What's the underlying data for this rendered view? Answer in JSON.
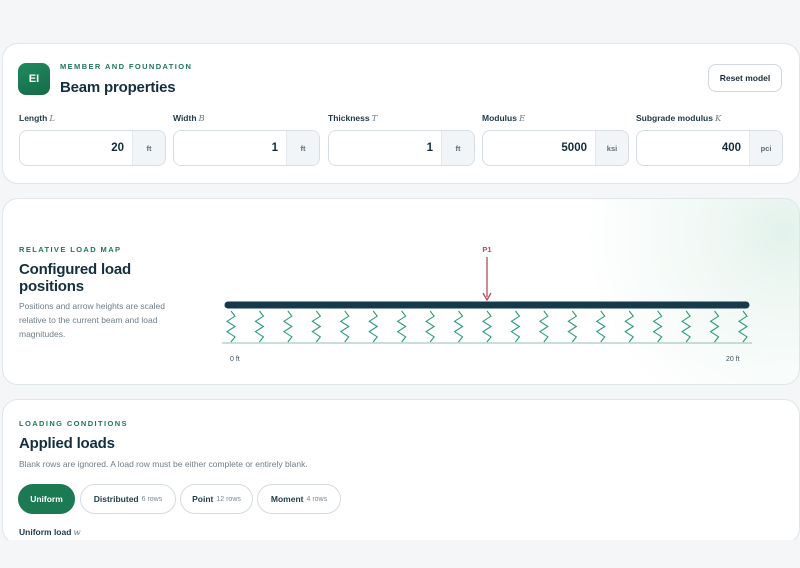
{
  "properties": {
    "badge": "EI",
    "eyebrow": "MEMBER AND FOUNDATION",
    "title": "Beam properties",
    "reset_label": "Reset model",
    "fields": [
      {
        "label": "Length",
        "symbol": "L",
        "value": "20",
        "unit": "ft"
      },
      {
        "label": "Width",
        "symbol": "B",
        "value": "1",
        "unit": "ft"
      },
      {
        "label": "Thickness",
        "symbol": "T",
        "value": "1",
        "unit": "ft"
      },
      {
        "label": "Modulus",
        "symbol": "E",
        "value": "5000",
        "unit": "ksi"
      },
      {
        "label": "Subgrade modulus",
        "symbol": "K",
        "value": "400",
        "unit": "pci"
      }
    ]
  },
  "load_map": {
    "eyebrow": "RELATIVE LOAD MAP",
    "title": "Configured load positions",
    "description": "Positions and arrow heights are scaled relative to the current beam and load magnitudes.",
    "beam_length_ft": 20,
    "start_label": "0 ft",
    "end_label": "20 ft",
    "springs_count": 19,
    "loads": [
      {
        "name": "P1",
        "position_ft": 10
      }
    ],
    "colors": {
      "beam": "#153a4b",
      "spring": "#2b9a76",
      "load": "#b84a5a"
    }
  },
  "loads": {
    "eyebrow": "LOADING CONDITIONS",
    "title": "Applied loads",
    "description": "Blank rows are ignored. A load row must be either complete or entirely blank.",
    "tabs": [
      {
        "label": "Uniform",
        "count": "",
        "active": true
      },
      {
        "label": "Distributed",
        "count": "6 rows",
        "active": false
      },
      {
        "label": "Point",
        "count": "12 rows",
        "active": false
      },
      {
        "label": "Moment",
        "count": "4 rows",
        "active": false
      }
    ],
    "uniform_label": "Uniform load",
    "uniform_symbol": "w"
  },
  "accent": "#1b7a54"
}
